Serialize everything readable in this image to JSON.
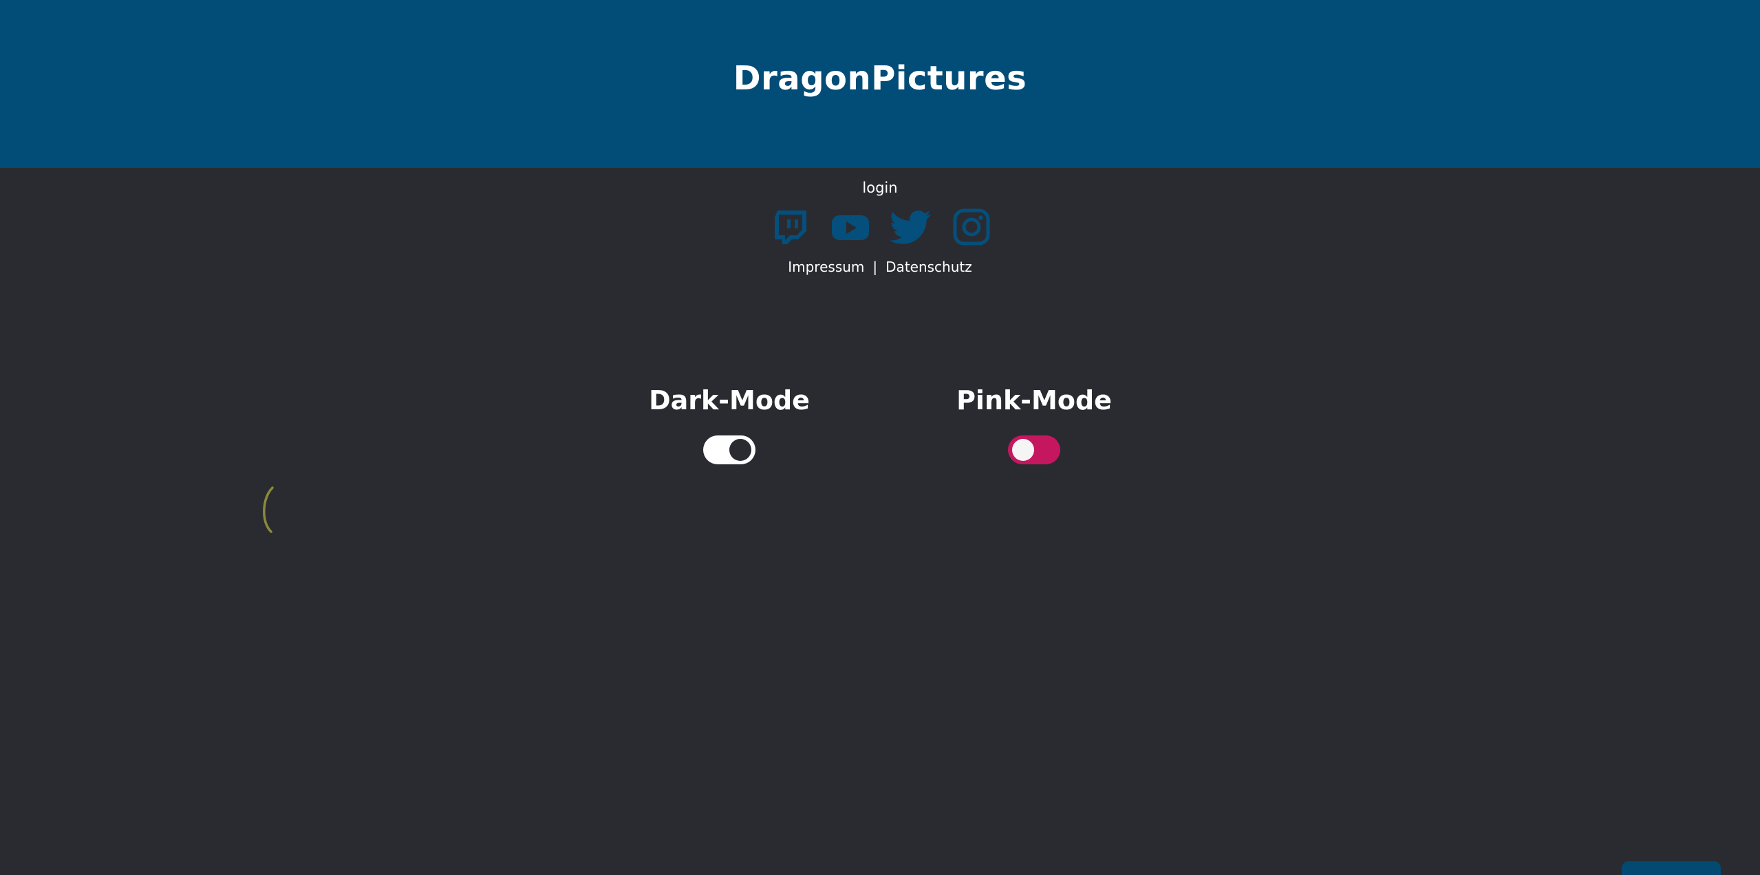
{
  "header": {
    "title": "DragonPictures"
  },
  "nav": {
    "login_label": "login"
  },
  "social": {
    "items": [
      {
        "name": "twitch",
        "icon": "twitch-icon"
      },
      {
        "name": "youtube",
        "icon": "youtube-icon"
      },
      {
        "name": "twitter",
        "icon": "twitter-icon"
      },
      {
        "name": "instagram",
        "icon": "instagram-icon"
      }
    ],
    "icon_color": "#044f7c"
  },
  "legal": {
    "impressum_label": "Impressum",
    "separator": "|",
    "datenschutz_label": "Datenschutz"
  },
  "modes": {
    "dark": {
      "label": "Dark-Mode",
      "enabled": true,
      "track_color": "#ffffff",
      "knob_color": "#2a2b30"
    },
    "pink": {
      "label": "Pink-Mode",
      "enabled": false,
      "track_color": "#c5175f",
      "knob_color": "#f5f5f5"
    }
  },
  "colors": {
    "header_bg": "#024c78",
    "page_bg": "#2a2b30",
    "text": "#ffffff"
  }
}
